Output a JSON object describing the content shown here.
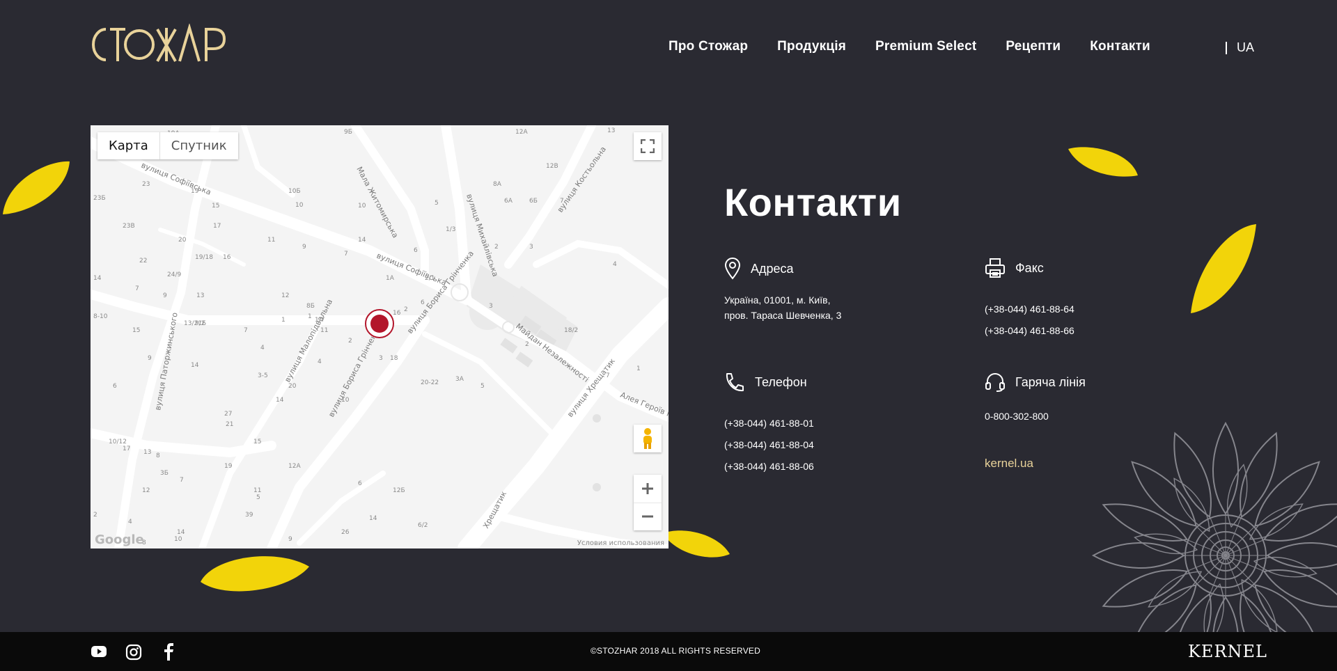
{
  "header": {
    "logo_text": "СТОЖАР",
    "nav": [
      "Про Стожар",
      "Продукція",
      "Premium Select",
      "Рецепти",
      "Контакти"
    ],
    "lang": "UA"
  },
  "map": {
    "tab_map": "Карта",
    "tab_satellite": "Спутник",
    "google": "Google",
    "terms": "Условия использования",
    "streets": [
      "вулиця Софіївська",
      "вулиця Софіївська",
      "вулиця Михайлівська",
      "Майдан Незалежності",
      "вулиця Бориса Грінченка",
      "вулиця Бориса Грінченка",
      "вулиця Хрещатик",
      "вулиця Малопідвальна",
      "вулиця Паторжинського",
      "вулиця Костьольна",
      "Мала Житомирська",
      "Алея Героїв Н",
      "Хрещатик"
    ],
    "numbers": [
      "19А",
      "9Б",
      "12А",
      "13",
      "23",
      "19",
      "10Б",
      "10",
      "8А",
      "12В",
      "23Б",
      "15",
      "10",
      "5",
      "6А",
      "6Б",
      "7",
      "23В",
      "20",
      "17",
      "11",
      "9",
      "14",
      "1/3",
      "2",
      "3",
      "22",
      "24/9",
      "19/18",
      "16",
      "7",
      "6",
      "2/1",
      "1А",
      "4",
      "14",
      "7",
      "9",
      "13",
      "12",
      "8Б",
      "1",
      "2",
      "6",
      "8-10",
      "15",
      "13/21Б",
      "9/2",
      "1",
      "1/7",
      "11",
      "7",
      "2",
      "16",
      "18/2",
      "3",
      "2",
      "9",
      "14",
      "4",
      "3",
      "4",
      "18",
      "7",
      "6",
      "3-5",
      "1",
      "20",
      "20-22",
      "3А",
      "5",
      "10",
      "14",
      "15",
      "27",
      "21",
      "10/12",
      "17",
      "13",
      "8",
      "19",
      "12А",
      "3Б",
      "7",
      "11",
      "5",
      "6",
      "12Б",
      "12",
      "39",
      "2",
      "4",
      "14",
      "10",
      "9",
      "26",
      "6/2",
      "14",
      "8"
    ]
  },
  "contacts": {
    "title": "Контакти",
    "address": {
      "label": "Адреса",
      "line1": "Україна, 01001, м. Київ,",
      "line2": "пров. Тараса Шевченка, 3"
    },
    "fax": {
      "label": "Факс",
      "phones": [
        "(+38-044) 461-88-64",
        "(+38-044) 461-88-66"
      ]
    },
    "phone": {
      "label": "Телефон",
      "phones": [
        "(+38-044) 461-88-01",
        "(+38-044) 461-88-04",
        "(+38-044) 461-88-06"
      ]
    },
    "hotline": {
      "label": "Гаряча лінія",
      "phone": "0-800-302-800"
    },
    "site": "kernel.ua"
  },
  "footer": {
    "copyright": "©STOZHAR 2018 ALL RIGHTS RESERVED",
    "brand": "KERNEL",
    "social": [
      "youtube-icon",
      "instagram-icon",
      "facebook-icon"
    ]
  },
  "colors": {
    "background": "#2a2a32",
    "footer": "#0a0a0a",
    "logo": "#e8d29a",
    "petal": "#f2d40a",
    "marker": "#b3162b"
  }
}
